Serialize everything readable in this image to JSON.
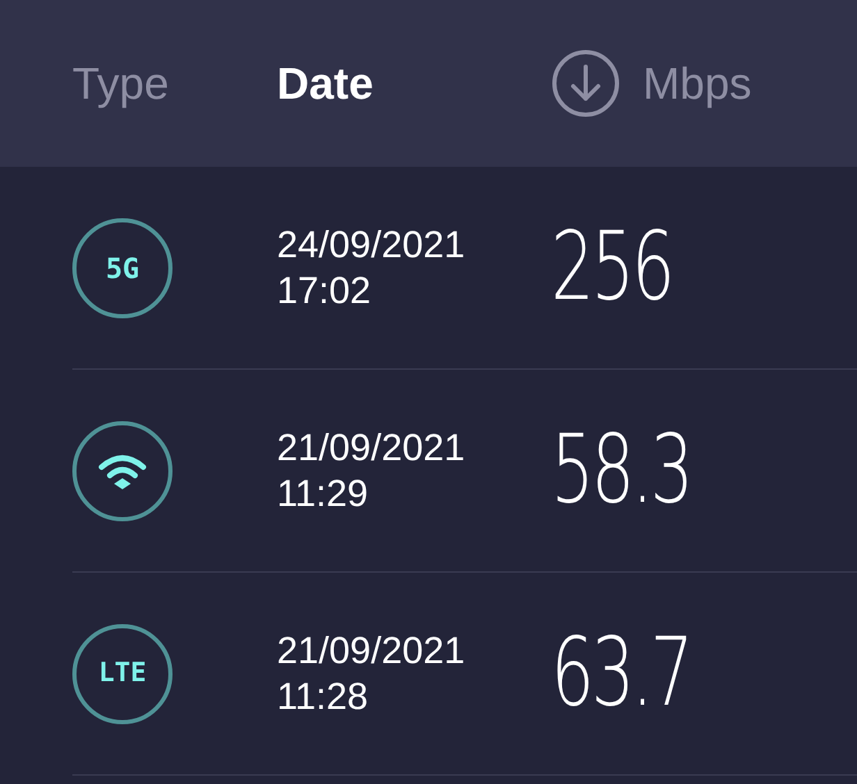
{
  "header": {
    "columns": [
      {
        "kind": "type",
        "label": "Type",
        "selected": false
      },
      {
        "kind": "date",
        "label": "Date",
        "selected": true
      },
      {
        "kind": "speed",
        "label": "Mbps",
        "selected": false
      }
    ]
  },
  "results": [
    {
      "kind": "fiveg",
      "badge": "5G",
      "date": "24/09/2021",
      "time": "17:02",
      "speed": "256"
    },
    {
      "kind": "wifi",
      "date": "21/09/2021",
      "time": "11:29",
      "speed": "58.3"
    },
    {
      "kind": "lte",
      "badge": "LTE",
      "date": "21/09/2021",
      "time": "11:28",
      "speed": "63.7"
    }
  ]
}
